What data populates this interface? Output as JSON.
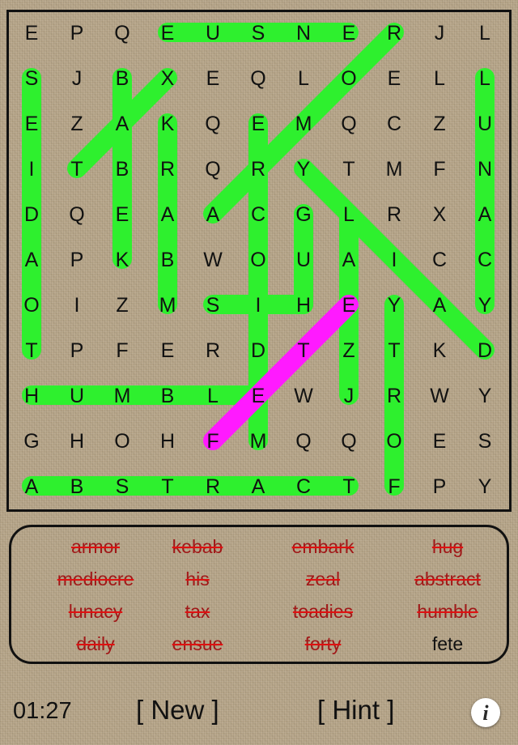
{
  "grid": [
    [
      "E",
      "P",
      "Q",
      "E",
      "U",
      "S",
      "N",
      "E",
      "R",
      "J",
      "L"
    ],
    [
      "S",
      "J",
      "B",
      "X",
      "E",
      "Q",
      "L",
      "O",
      "E",
      "L",
      "L"
    ],
    [
      "E",
      "Z",
      "A",
      "K",
      "Q",
      "E",
      "M",
      "Q",
      "C",
      "Z",
      "U"
    ],
    [
      "I",
      "T",
      "B",
      "R",
      "Q",
      "R",
      "Y",
      "T",
      "M",
      "F",
      "N"
    ],
    [
      "D",
      "Q",
      "E",
      "A",
      "A",
      "C",
      "G",
      "L",
      "R",
      "X",
      "A"
    ],
    [
      "A",
      "P",
      "K",
      "B",
      "W",
      "O",
      "U",
      "A",
      "I",
      "C",
      "C"
    ],
    [
      "O",
      "I",
      "Z",
      "M",
      "S",
      "I",
      "H",
      "E",
      "Y",
      "A",
      "Y"
    ],
    [
      "T",
      "P",
      "F",
      "E",
      "R",
      "D",
      "T",
      "Z",
      "T",
      "K",
      "D"
    ],
    [
      "H",
      "U",
      "M",
      "B",
      "L",
      "E",
      "W",
      "J",
      "R",
      "W",
      "Y"
    ],
    [
      "G",
      "H",
      "O",
      "H",
      "F",
      "M",
      "Q",
      "Q",
      "O",
      "E",
      "S"
    ],
    [
      "A",
      "B",
      "S",
      "T",
      "R",
      "A",
      "C",
      "T",
      "F",
      "P",
      "Y"
    ]
  ],
  "colors": {
    "found_highlight": "#2ef02e",
    "current_highlight": "#ff1aff",
    "crossed_text": "#a01818",
    "strike_line": "#e01010"
  },
  "found_highlights": [
    {
      "word": "ensue",
      "from": [
        0,
        3
      ],
      "to": [
        0,
        7
      ]
    },
    {
      "word": "forty",
      "from": [
        10,
        8
      ],
      "to": [
        6,
        8
      ]
    },
    {
      "word": "abstract",
      "from": [
        10,
        0
      ],
      "to": [
        10,
        7
      ]
    },
    {
      "word": "humble",
      "from": [
        8,
        0
      ],
      "to": [
        8,
        5
      ]
    },
    {
      "word": "daily",
      "from": [
        4,
        7
      ],
      "to": [
        8,
        7
      ]
    },
    {
      "word": "tax",
      "from": [
        3,
        1
      ],
      "to": [
        1,
        3
      ]
    },
    {
      "word": "embark",
      "from": [
        2,
        5
      ],
      "to": [
        9,
        5
      ]
    },
    {
      "word": "armor",
      "from": [
        0,
        8
      ],
      "to": [
        4,
        4
      ]
    },
    {
      "word": "lunacy",
      "from": [
        1,
        10
      ],
      "to": [
        6,
        10
      ]
    },
    {
      "word": "zeal",
      "from": [
        7,
        7
      ],
      "to": [
        4,
        7
      ]
    },
    {
      "word": "his",
      "from": [
        6,
        6
      ],
      "to": [
        6,
        4
      ]
    },
    {
      "word": "kebab",
      "from": [
        5,
        2
      ],
      "to": [
        1,
        2
      ]
    },
    {
      "word": "toadies",
      "from": [
        7,
        0
      ],
      "to": [
        1,
        0
      ]
    },
    {
      "word": "hug",
      "from": [
        6,
        6
      ],
      "to": [
        4,
        6
      ]
    },
    {
      "word": "mediocre",
      "from": [
        6,
        3
      ],
      "to": [
        2,
        3
      ]
    },
    {
      "word": "mediocre",
      "from": [
        3,
        6
      ],
      "to": [
        7,
        10
      ]
    }
  ],
  "current_selection": {
    "from": [
      9,
      4
    ],
    "to": [
      6,
      7
    ]
  },
  "words": [
    {
      "text": "armor",
      "found": true
    },
    {
      "text": "kebab",
      "found": true
    },
    {
      "text": "embark",
      "found": true
    },
    {
      "text": "hug",
      "found": true
    },
    {
      "text": "mediocre",
      "found": true
    },
    {
      "text": "his",
      "found": true
    },
    {
      "text": "zeal",
      "found": true
    },
    {
      "text": "abstract",
      "found": true
    },
    {
      "text": "lunacy",
      "found": true
    },
    {
      "text": "tax",
      "found": true
    },
    {
      "text": "toadies",
      "found": true
    },
    {
      "text": "humble",
      "found": true
    },
    {
      "text": "daily",
      "found": true
    },
    {
      "text": "ensue",
      "found": true
    },
    {
      "text": "forty",
      "found": true
    },
    {
      "text": "fete",
      "found": false
    }
  ],
  "footer": {
    "timer": "01:27",
    "new_label": "[ New ]",
    "hint_label": "[ Hint ]",
    "info_icon": "info-icon",
    "info_glyph": "i"
  }
}
